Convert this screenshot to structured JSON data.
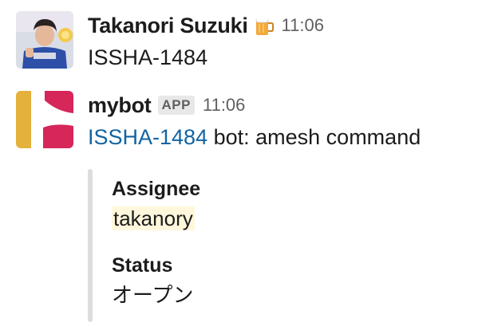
{
  "messages": [
    {
      "sender": "Takanori Suzuki",
      "status_emoji": "beer-mug-icon",
      "time": "11:06",
      "text": "ISSHA-1484"
    },
    {
      "sender": "mybot",
      "badge": "APP",
      "time": "11:06",
      "link_text": "ISSHA-1484",
      "text": " bot: amesh command",
      "attachment": {
        "fields": [
          {
            "title": "Assignee",
            "value": "takanory"
          },
          {
            "title": "Status",
            "value": "オープン"
          }
        ]
      }
    }
  ],
  "colors": {
    "text": "#1d1c1d",
    "muted": "#616061",
    "link": "#1264a3",
    "attachment_bar": "#dddddd",
    "highlight": "#fef7dc",
    "bot_logo_yellow": "#e3b13c",
    "bot_logo_pink": "#d6265a"
  }
}
